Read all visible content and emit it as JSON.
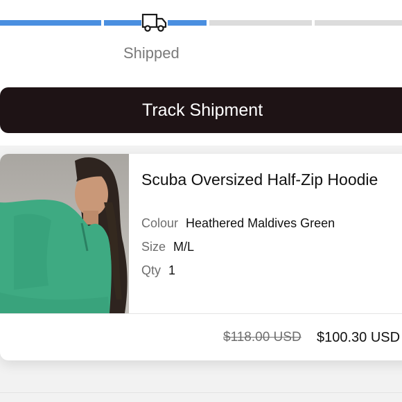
{
  "progress": {
    "segments": [
      {
        "state": "complete"
      },
      {
        "state": "complete"
      },
      {
        "state": "incomplete"
      },
      {
        "state": "incomplete"
      }
    ],
    "colors": {
      "complete": "#4a8fe0",
      "incomplete": "#dcdcdc"
    },
    "current_icon": "truck-icon",
    "status_label": "Shipped"
  },
  "actions": {
    "track_label": "Track Shipment"
  },
  "order_item": {
    "image_icon": "product-photo",
    "title": "Scuba Oversized Half-Zip Hoodie",
    "colour_label": "Colour",
    "colour_value": "Heathered Maldives Green",
    "size_label": "Size",
    "size_value": "M/L",
    "qty_label": "Qty",
    "qty_value": "1",
    "price_original": "$118.00 USD",
    "price_current": "$100.30 USD"
  }
}
